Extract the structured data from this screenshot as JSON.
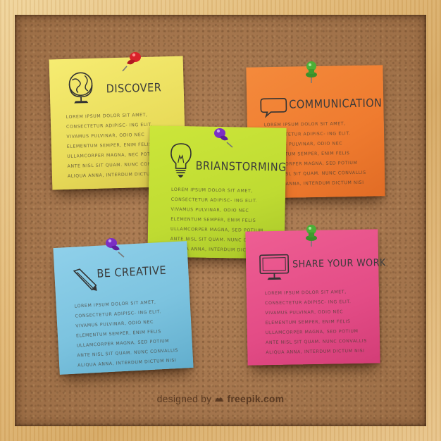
{
  "notes": {
    "discover": {
      "title": "DISCOVER",
      "body": "LOREM IPSUM DOLOR SIT AMET, CONSECTETUR ADIPISC- ING ELIT. VIVAMUS PULVINAR, ODIO NEC ELEMENTUM SEMPER, ENIM FELIS ULLAMCORPER MAGNA, NEC POTIUM ANTE NISL SIT QUAM. NUNC CONVALLIS ALIQUA ANNA, INTERDUM DICTUM NISI",
      "color": "#f1e566",
      "icon": "globe-icon",
      "pin": "#d8222a"
    },
    "communication": {
      "title": "COMMUNICATION",
      "body": "LOREM IPSUM DOLOR SIT AMET, CONSECTETUR ADIPISC- ING ELIT. VIVAMUS PULVINAR, ODIO NEC ELEMENTUM SEMPER, ENIM FELIS ULLAMCORPER MAGNA, SED POTIUM ANTE NISL SIT QUAM. NUNC CONVALLIS ALIQUA ANNA, INTERDUM DICTUM NISI",
      "color": "#f08334",
      "icon": "speech-bubble-icon",
      "pin": "#4caf37"
    },
    "brainstorming": {
      "title": "BRIANSTORMING",
      "body": "LOREM IPSUM DOLOR SIT AMET, CONSECTETUR ADIPISC- ING ELIT. VIVAMUS PULVINAR, ODIO NEC ELEMENTUM SEMPER, ENIM FELIS ULLAMCORPER MAGNA, SED POTIUM ANTE NISL SIT QUAM. NUNC CONVALLIS ALIQUA ANNA, INTERDUM DICTUM NISI",
      "color": "#c4e036",
      "icon": "light-bulb-icon",
      "pin": "#7b2fc4"
    },
    "creative": {
      "title": "BE CREATIVE",
      "body": "LOREM IPSUM DOLOR SIT AMET, CONSECTETUR ADIPISC- ING ELIT. VIVAMUS PULVINAR, ODIO NEC ELEMENTUM SEMPER, ENIM FELIS ULLAMCORPER MAGNA, SED POTIUM ANTE NISL SIT QUAM. NUNC CONVALLIS ALIQUA ANNA, INTERDUM DICTUM NISI",
      "color": "#80c6e2",
      "icon": "pencil-icon",
      "pin": "#7b2fc4"
    },
    "share": {
      "title": "SHARE YOUR WORK",
      "body": "LOREM IPSUM DOLOR SIT AMET, CONSECTETUR ADIPISC- ING ELIT. VIVAMUS PULVINAR, ODIO NEC ELEMENTUM SEMPER, ENIM FELIS ULLAMCORPER MAGNA, SED POTIUM ANTE NISL SIT QUAM. NUNC CONVALLIS ALIQUA ANNA, INTERDUM DICTUM NISI",
      "color": "#e6528a",
      "icon": "monitor-icon",
      "pin": "#4caf37"
    }
  },
  "credit": {
    "prefix": "designed by",
    "brand": "freepik.com",
    "icon": "freepik-logo-icon"
  },
  "colors": {
    "frame": "#e2b976",
    "cork": "#a9794f"
  }
}
